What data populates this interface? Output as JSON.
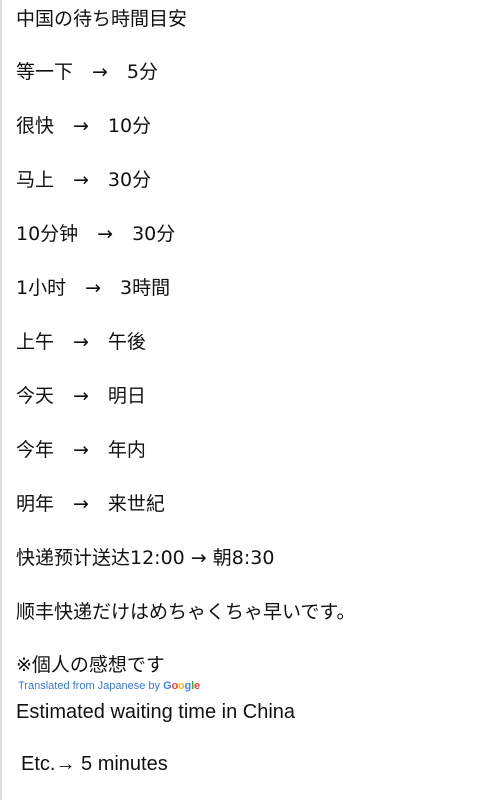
{
  "post": {
    "title": "中国の待ち時間目安",
    "rows": [
      "等一下　→　5分",
      "很快　→　10分",
      "马上　→　30分",
      "10分钟　→　30分",
      "1小时　→　3時間",
      "上午　→　午後",
      "今天　→　明日",
      "今年　→　年内",
      "明年　→　来世紀",
      "快递预计送达12:00 → 朝8:30",
      "顺丰快递だけはめちゃくちゃ早いです。"
    ],
    "note": "※個人の感想です"
  },
  "translation": {
    "prefix": "Translated from Japanese by ",
    "brand_letters": [
      "G",
      "o",
      "o",
      "g",
      "l",
      "e"
    ],
    "title": "Estimated waiting time in China",
    "first_item": "Etc.→ 5 minutes"
  },
  "colors": {
    "link": "#3a79c9",
    "google_blue": "#4285f4",
    "google_red": "#ea4335",
    "google_yellow": "#fbbc05",
    "google_green": "#34a853"
  }
}
